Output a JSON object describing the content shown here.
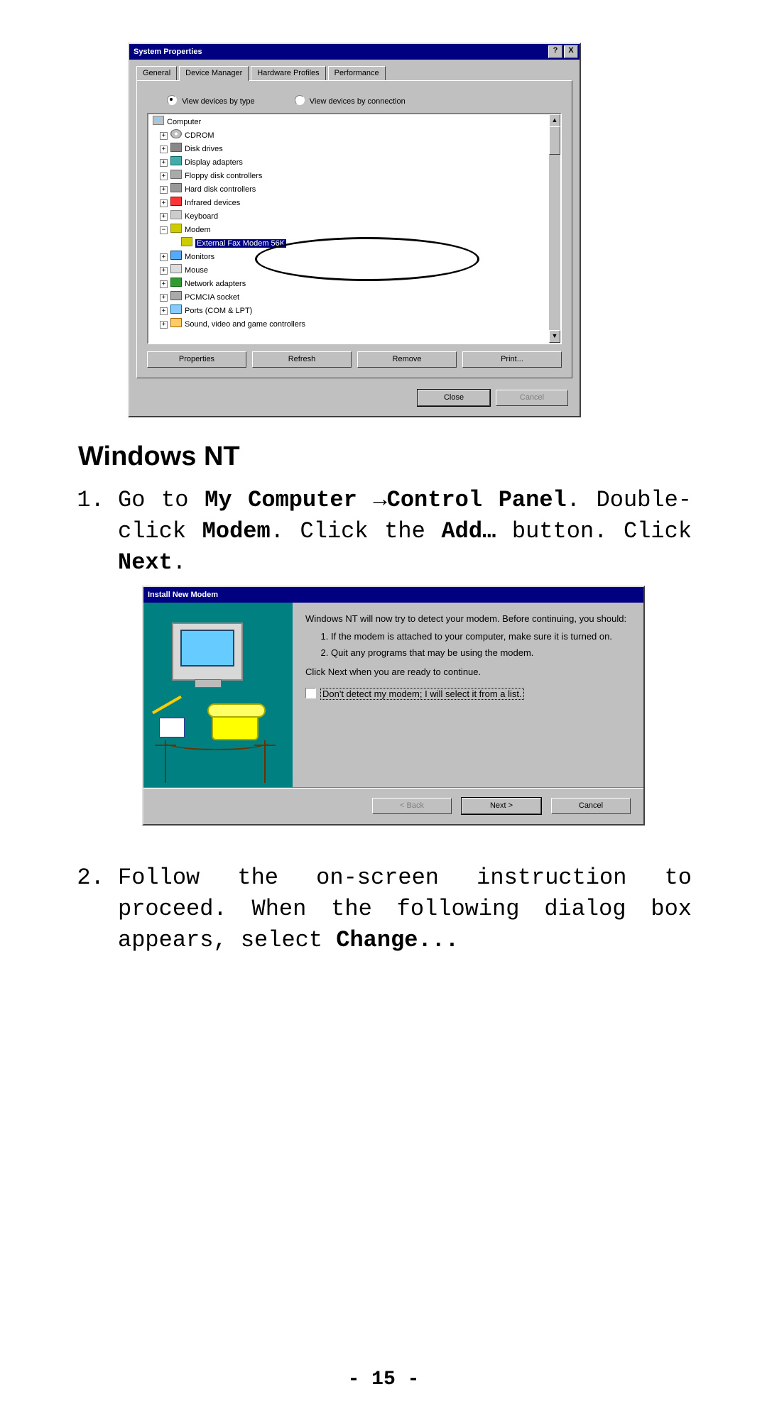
{
  "dlg1": {
    "title": "System Properties",
    "help": "?",
    "close": "X",
    "tabs": [
      "General",
      "Device Manager",
      "Hardware Profiles",
      "Performance"
    ],
    "activeTab": 1,
    "radio_type": "View devices by type",
    "radio_conn": "View devices by connection",
    "tree": {
      "root": "Computer",
      "items": [
        {
          "l": "CDROM",
          "i": "cd"
        },
        {
          "l": "Disk drives",
          "i": "disk"
        },
        {
          "l": "Display adapters",
          "i": "disp"
        },
        {
          "l": "Floppy disk controllers",
          "i": "fd"
        },
        {
          "l": "Hard disk controllers",
          "i": "hd"
        },
        {
          "l": "Infrared devices",
          "i": "ir"
        },
        {
          "l": "Keyboard",
          "i": "kb"
        },
        {
          "l": "Modem",
          "i": "md",
          "open": true,
          "child": "External Fax Modem 56K"
        },
        {
          "l": "Monitors",
          "i": "mn"
        },
        {
          "l": "Mouse",
          "i": "ms"
        },
        {
          "l": "Network adapters",
          "i": "na"
        },
        {
          "l": "PCMCIA socket",
          "i": "pc"
        },
        {
          "l": "Ports (COM & LPT)",
          "i": "pt"
        },
        {
          "l": "Sound, video and game controllers",
          "i": "sv"
        }
      ]
    },
    "buttons": {
      "properties": "Properties",
      "refresh": "Refresh",
      "remove": "Remove",
      "print": "Print..."
    },
    "close_btn": "Close",
    "cancel_btn": "Cancel"
  },
  "doc": {
    "heading": "Windows NT",
    "s1a": "Go to ",
    "s1b": "My Computer ",
    "s1arrow": "→",
    "s1c": "Control Panel",
    "s1d": ". Double-click ",
    "s1e": "Modem",
    "s1f": ". Click the ",
    "s1g": "Add…",
    "s1h": " button. Click ",
    "s1i": "Next",
    "s1j": ".",
    "s2a": "Follow the on-screen instruction to proceed. When the following dialog box appears, select ",
    "s2b": "Change...",
    "page": "- 15 -"
  },
  "dlg2": {
    "title": "Install New Modem",
    "intro": "Windows NT will now try to detect your modem.  Before continuing, you should:",
    "li1": "If the modem is attached to your computer, make sure it is turned on.",
    "li2": "Quit any programs that may be using the modem.",
    "cont": "Click Next when you are ready to continue.",
    "checkbox": "Don't detect my modem; I will select it from a list.",
    "back": "< Back",
    "next": "Next >",
    "cancel": "Cancel"
  }
}
